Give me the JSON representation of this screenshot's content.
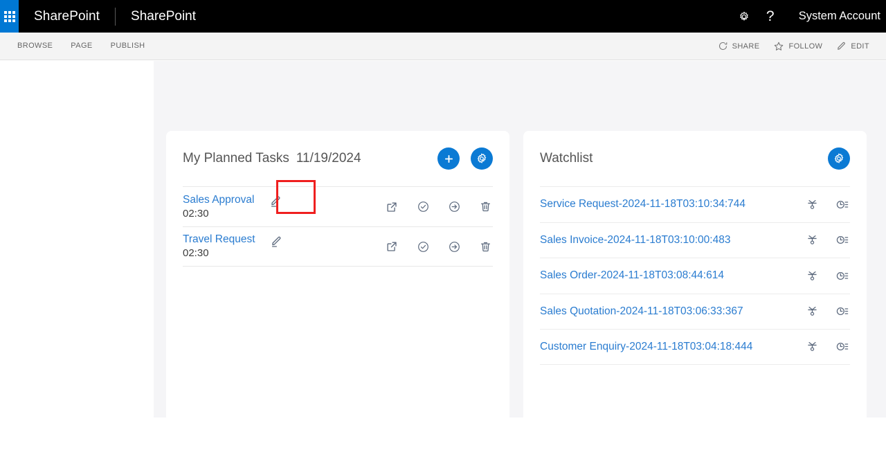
{
  "suite": {
    "waffle_icon": "app-launcher-icon",
    "brand": "SharePoint",
    "site": "SharePoint",
    "settings_icon": "gear-icon",
    "help_icon": "help-icon",
    "help_glyph": "?",
    "user": "System Account"
  },
  "ribbon": {
    "tabs": [
      {
        "label": "BROWSE"
      },
      {
        "label": "PAGE"
      },
      {
        "label": "PUBLISH"
      }
    ],
    "actions": [
      {
        "label": "SHARE",
        "icon": "share-icon"
      },
      {
        "label": "FOLLOW",
        "icon": "star-icon"
      },
      {
        "label": "EDIT",
        "icon": "pencil-icon"
      }
    ]
  },
  "tasks_card": {
    "title": "My Planned Tasks",
    "date": "11/19/2024",
    "add_icon": "plus-icon",
    "settings_icon": "gear-icon",
    "rows": [
      {
        "name": "Sales Approval",
        "time": "02:30",
        "edit_icon": "pencil-icon",
        "actions": [
          "open-external-icon",
          "check-circle-icon",
          "arrow-right-circle-icon",
          "trash-icon"
        ]
      },
      {
        "name": "Travel Request",
        "time": "02:30",
        "edit_icon": "pencil-icon",
        "actions": [
          "open-external-icon",
          "check-circle-icon",
          "arrow-right-circle-icon",
          "trash-icon"
        ]
      }
    ]
  },
  "watchlist_card": {
    "title": "Watchlist",
    "settings_icon": "gear-icon",
    "rows": [
      {
        "name": "Service Request-2024-11-18T03:10:34:744",
        "actions": [
          "workflow-icon",
          "history-icon"
        ]
      },
      {
        "name": "Sales Invoice-2024-11-18T03:10:00:483",
        "actions": [
          "workflow-icon",
          "history-icon"
        ]
      },
      {
        "name": "Sales Order-2024-11-18T03:08:44:614",
        "actions": [
          "workflow-icon",
          "history-icon"
        ]
      },
      {
        "name": "Sales Quotation-2024-11-18T03:06:33:367",
        "actions": [
          "workflow-icon",
          "history-icon"
        ]
      },
      {
        "name": "Customer Enquiry-2024-11-18T03:04:18:444",
        "actions": [
          "workflow-icon",
          "history-icon"
        ]
      }
    ]
  },
  "highlight": {
    "target": "sales-approval-edit-icon",
    "color": "#ef1f1f"
  },
  "colors": {
    "suite_bar": "#000000",
    "accent_blue": "#0b7ad4",
    "waffle_blue": "#0078d4",
    "link_blue": "#2a7cd0",
    "page_bg": "#f5f5f7",
    "ribbon_bg": "#f4f4f4",
    "highlight_red": "#ef1f1f"
  }
}
